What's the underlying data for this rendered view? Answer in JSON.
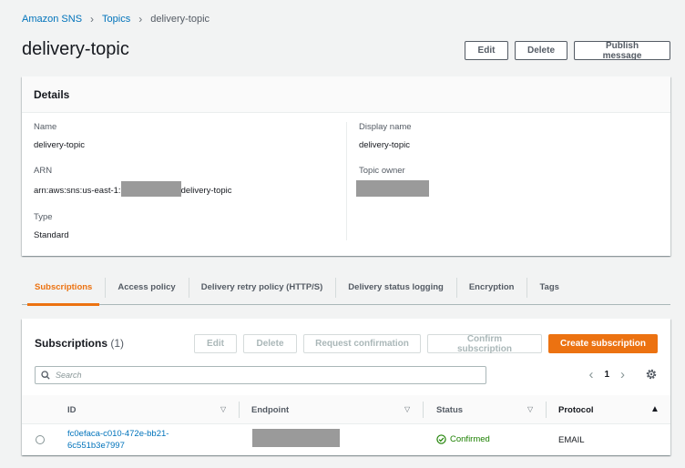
{
  "breadcrumb": {
    "items": [
      "Amazon SNS",
      "Topics"
    ],
    "current": "delivery-topic"
  },
  "page": {
    "title": "delivery-topic",
    "actions": {
      "edit": "Edit",
      "delete": "Delete",
      "publish": "Publish message"
    }
  },
  "details": {
    "title": "Details",
    "name_label": "Name",
    "name_value": "delivery-topic",
    "arn_label": "ARN",
    "arn_prefix": "arn:aws:sns:us-east-1:",
    "arn_suffix": "delivery-topic",
    "type_label": "Type",
    "type_value": "Standard",
    "display_name_label": "Display name",
    "display_name_value": "delivery-topic",
    "owner_label": "Topic owner"
  },
  "tabs": [
    "Subscriptions",
    "Access policy",
    "Delivery retry policy (HTTP/S)",
    "Delivery status logging",
    "Encryption",
    "Tags"
  ],
  "subscriptions": {
    "title": "Subscriptions",
    "count": "(1)",
    "actions": {
      "edit": "Edit",
      "delete": "Delete",
      "request": "Request confirmation",
      "confirm": "Confirm subscription",
      "create": "Create subscription"
    },
    "search_placeholder": "Search",
    "page": "1",
    "columns": {
      "id": "ID",
      "endpoint": "Endpoint",
      "status": "Status",
      "protocol": "Protocol"
    },
    "rows": [
      {
        "id_line1": "fc0efaca-c010-472e-bb21-",
        "id_line2": "6c551b3e7997",
        "status": "Confirmed",
        "protocol": "EMAIL"
      }
    ]
  },
  "colors": {
    "link": "#0073bb",
    "primary": "#ec7211",
    "success": "#1d8102"
  },
  "icons": [
    "chevron-right-icon",
    "search-icon",
    "chevron-left-icon",
    "gear-icon",
    "sort-down-icon",
    "sort-up-icon",
    "check-circle-icon"
  ]
}
